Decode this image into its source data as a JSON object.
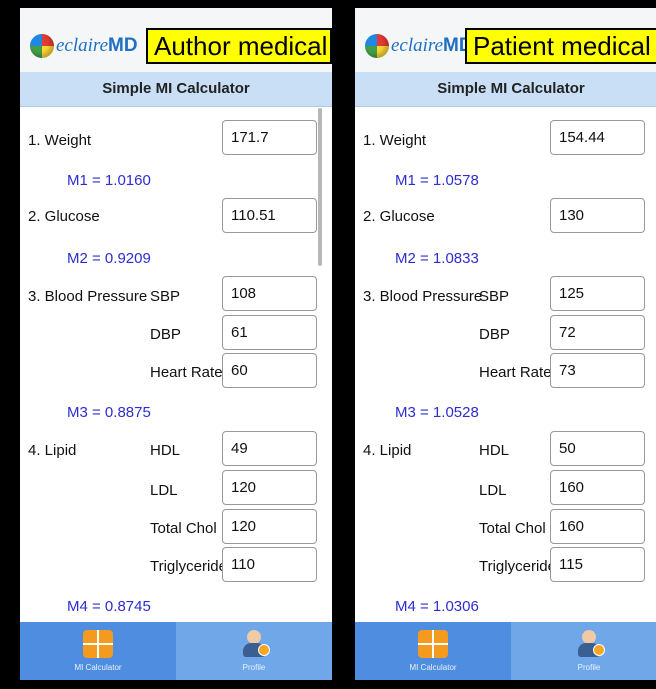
{
  "panels": [
    {
      "logo_text": "eclaire",
      "logo_md": "MD",
      "role_label": "Author medical",
      "title": "Simple MI Calculator",
      "weight_label": "1. Weight",
      "weight_value": "171.7",
      "m1": "M1 = 1.0160",
      "glucose_label": "2. Glucose",
      "glucose_value": "110.51",
      "m2": "M2 = 0.9209",
      "bp_label": "3. Blood Pressure",
      "sbp_label": "SBP",
      "sbp_value": "108",
      "dbp_label": "DBP",
      "dbp_value": "61",
      "hr_label": "Heart Rate",
      "hr_value": "60",
      "m3": "M3 = 0.8875",
      "lipid_label": "4. Lipid",
      "hdl_label": "HDL",
      "hdl_value": "49",
      "ldl_label": "LDL",
      "ldl_value": "120",
      "chol_label": "Total Chol",
      "chol_value": "120",
      "trig_label": "Triglyceride",
      "trig_value": "110",
      "m4": "M4 = 0.8745",
      "tab_calc": "MI Calculator",
      "tab_profile": "Profile"
    },
    {
      "logo_text": "eclaire",
      "logo_md": "MD",
      "role_label": "Patient medical",
      "title": "Simple MI Calculator",
      "weight_label": "1. Weight",
      "weight_value": "154.44",
      "m1": "M1 = 1.0578",
      "glucose_label": "2. Glucose",
      "glucose_value": "130",
      "m2": "M2 = 1.0833",
      "bp_label": "3. Blood Pressure",
      "sbp_label": "SBP",
      "sbp_value": "125",
      "dbp_label": "DBP",
      "dbp_value": "72",
      "hr_label": "Heart Rate",
      "hr_value": "73",
      "m3": "M3 = 1.0528",
      "lipid_label": "4. Lipid",
      "hdl_label": "HDL",
      "hdl_value": "50",
      "ldl_label": "LDL",
      "ldl_value": "160",
      "chol_label": "Total Chol",
      "chol_value": "160",
      "trig_label": "Triglyceride",
      "trig_value": "115",
      "m4": "M4 = 1.0306",
      "tab_calc": "MI Calculator",
      "tab_profile": "Profile"
    }
  ]
}
